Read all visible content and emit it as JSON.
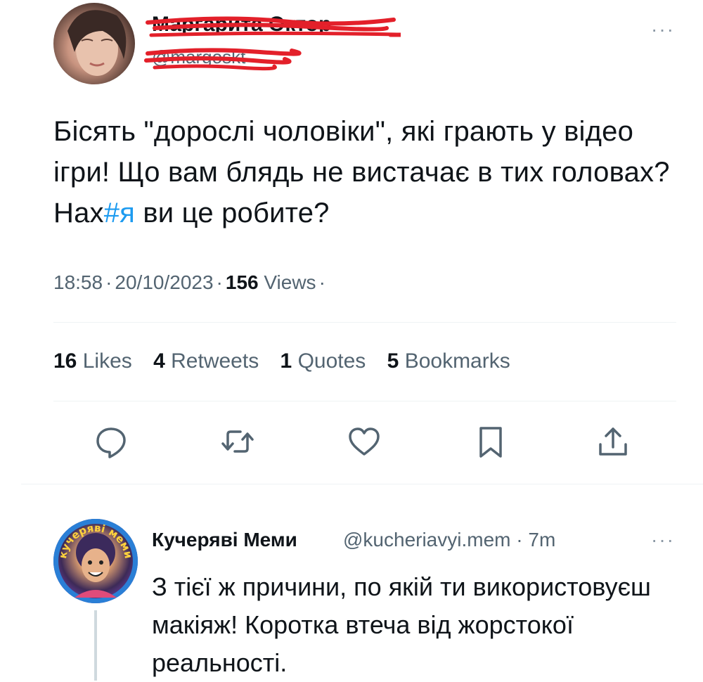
{
  "tweet": {
    "author": {
      "display_name": "Маргарита Октор",
      "handle": "@margoskt"
    },
    "text_before": "Бісять \"дорослі чоловіки\", які грають у відео ігри! Що вам блядь не вистачає в тих головах? Нах",
    "hashtag": "#я",
    "text_after": " ви це робите?",
    "time": "18:58",
    "date": "20/10/2023",
    "views_count": "156",
    "views_label": "Views",
    "more_label": "···",
    "stats": [
      {
        "count": "16",
        "label": "Likes"
      },
      {
        "count": "4",
        "label": "Retweets"
      },
      {
        "count": "1",
        "label": "Quotes"
      },
      {
        "count": "5",
        "label": "Bookmarks"
      }
    ],
    "actions": [
      "reply-icon",
      "retweet-icon",
      "like-icon",
      "bookmark-icon",
      "share-icon"
    ]
  },
  "reply": {
    "display_name": "Кучеряві Меми",
    "handle": "@kucheriavyi.mem",
    "time": "7m",
    "avatar_text": "кучеряві меми",
    "more_label": "···",
    "text": "З тієї ж причини, по якій ти використовуєш макіяж! Коротка втеча від жорстокої реальності."
  },
  "colors": {
    "text": "#0f1419",
    "secondary": "#536471",
    "accent": "#1d9bf0",
    "scribble": "#e3202a",
    "divider": "#eff3f4"
  }
}
